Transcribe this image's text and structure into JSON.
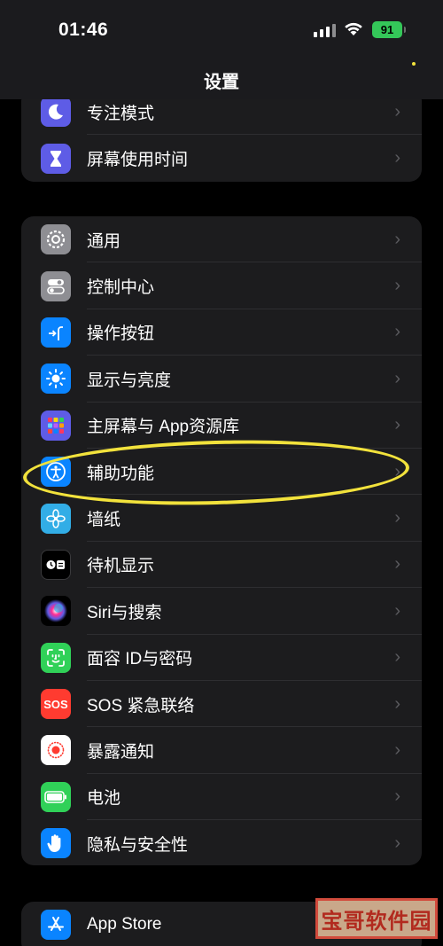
{
  "status": {
    "time": "01:46",
    "battery": "91"
  },
  "nav": {
    "title": "设置"
  },
  "group1": [
    {
      "label": "专注模式",
      "icon": "moon-icon",
      "color": "#5e5ce6"
    },
    {
      "label": "屏幕使用时间",
      "icon": "hourglass-icon",
      "color": "#5e5ce6"
    }
  ],
  "group2": [
    {
      "label": "通用",
      "icon": "gear-icon",
      "color": "#8e8e93"
    },
    {
      "label": "控制中心",
      "icon": "toggles-icon",
      "color": "#8e8e93"
    },
    {
      "label": "操作按钮",
      "icon": "action-button-icon",
      "color": "#0a84ff"
    },
    {
      "label": "显示与亮度",
      "icon": "sun-icon",
      "color": "#0a84ff"
    },
    {
      "label": "主屏幕与 App资源库",
      "icon": "app-grid-icon",
      "color": "#5e5ce6"
    },
    {
      "label": "辅助功能",
      "icon": "accessibility-icon",
      "color": "#0a84ff"
    },
    {
      "label": "墙纸",
      "icon": "flower-icon",
      "color": "#32ade6"
    },
    {
      "label": "待机显示",
      "icon": "standby-icon",
      "color": "#1c1c1e"
    },
    {
      "label": "Siri与搜索",
      "icon": "siri-icon",
      "color": "#2c2c2e"
    },
    {
      "label": "面容 ID与密码",
      "icon": "face-id-icon",
      "color": "#30d158"
    },
    {
      "label": "SOS 紧急联络",
      "icon": "sos-icon",
      "color": "#ff3b30"
    },
    {
      "label": "暴露通知",
      "icon": "exposure-icon",
      "color": "#ffffff"
    },
    {
      "label": "电池",
      "icon": "battery-icon",
      "color": "#30d158"
    },
    {
      "label": "隐私与安全性",
      "icon": "hand-icon",
      "color": "#0a84ff"
    }
  ],
  "group3": [
    {
      "label": "App Store",
      "icon": "app-store-icon",
      "color": "#0a84ff"
    }
  ],
  "icons": {
    "sos_text": "SOS"
  },
  "watermark": "宝哥软件园"
}
